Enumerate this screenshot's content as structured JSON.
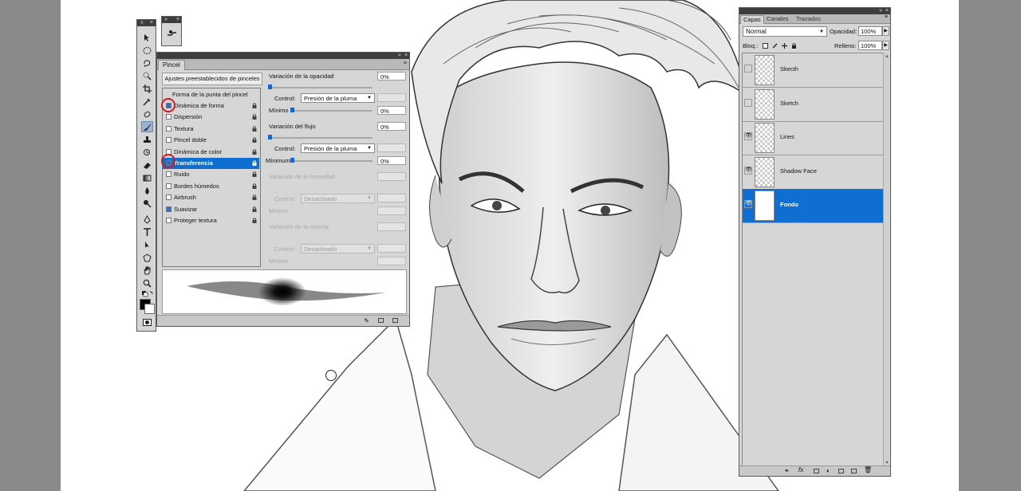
{
  "brush_panel": {
    "tab": "Pincel",
    "presets_button": "Ajustes preestablecidos de pinceles",
    "list_header": "Forma de la punta del pincel",
    "items": [
      {
        "label": "Dinámica de forma",
        "checked": true
      },
      {
        "label": "Dispersión",
        "checked": false
      },
      {
        "label": "Textura",
        "checked": false
      },
      {
        "label": "Pincel doble",
        "checked": false
      },
      {
        "label": "Dinámica de color",
        "checked": false
      },
      {
        "label": "Transferencia",
        "checked": true,
        "selected": true
      },
      {
        "label": "Ruido",
        "checked": false
      },
      {
        "label": "Bordes húmedos",
        "checked": false
      },
      {
        "label": "Airbrush",
        "checked": false
      },
      {
        "label": "Suavizar",
        "checked": true
      },
      {
        "label": "Proteger textura",
        "checked": false
      }
    ],
    "opacity_jitter": {
      "label": "Variación de la opacidad",
      "value": "0%",
      "control_label": "Control:",
      "control_value": "Presión de la pluma",
      "min_label": "Mínimo",
      "min_value": "0%"
    },
    "flow_jitter": {
      "label": "Variación del flujo",
      "value": "0%",
      "control_label": "Control:",
      "control_value": "Presión de la pluma",
      "min_label": "Mínimum",
      "min_value": "0%"
    },
    "wetness_jitter": {
      "label": "Variación de la humedad",
      "control_label": "Control:",
      "control_value": "Desactivado",
      "min_label": "Mínimo"
    },
    "mix_jitter": {
      "label": "Variación de la mezcla",
      "control_label": "Control:",
      "control_value": "Desactivado",
      "min_label": "Mínimo"
    }
  },
  "layers_panel": {
    "tabs": [
      "Capas",
      "Canales",
      "Trazados"
    ],
    "blend_mode": "Normal",
    "opacity_label": "Opacidad:",
    "opacity_value": "100%",
    "lock_label": "Bloq.:",
    "fill_label": "Relleno:",
    "fill_value": "100%",
    "layers": [
      {
        "name": "Skecth",
        "visible": false,
        "selected": false
      },
      {
        "name": "Sketch",
        "visible": false,
        "selected": false
      },
      {
        "name": "Lines",
        "visible": true,
        "selected": false
      },
      {
        "name": "Shadow Face",
        "visible": true,
        "selected": false
      },
      {
        "name": "Fondo",
        "visible": true,
        "selected": true
      }
    ]
  },
  "colors": {
    "accent": "#0e6fd0",
    "highlight_ring": "#d11a24"
  }
}
